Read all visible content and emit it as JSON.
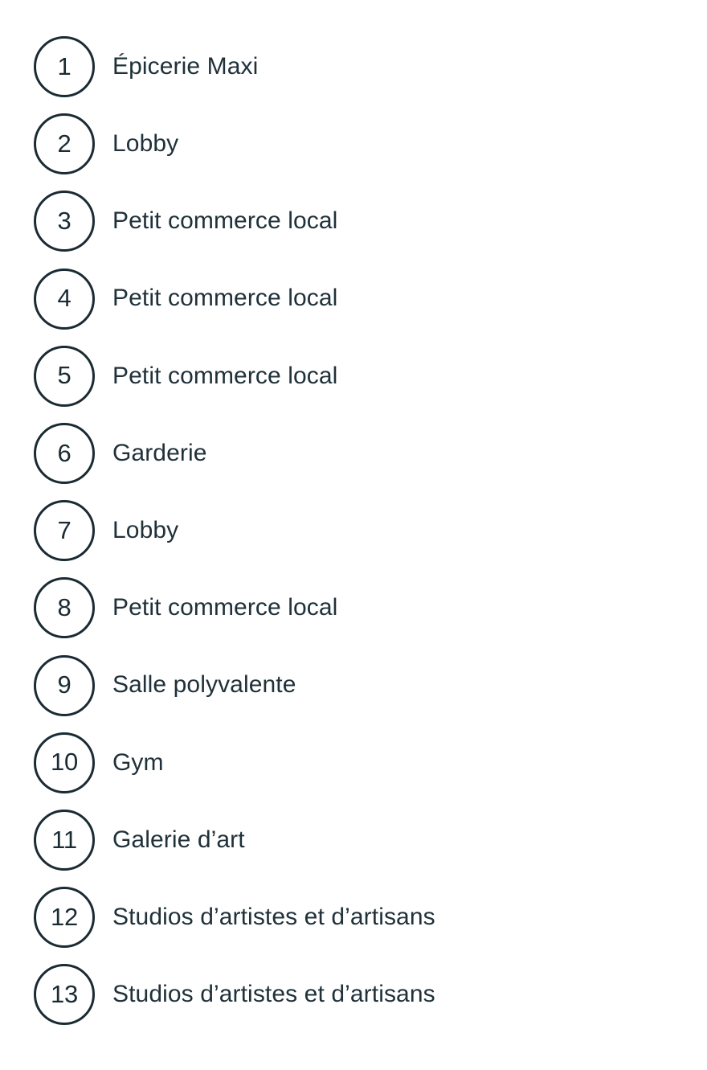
{
  "page": {
    "background_color": "#ffffff",
    "accent_color": "#1b2b33",
    "text_color": "#20313a"
  },
  "legend": {
    "items": [
      {
        "number": "1",
        "label": "Épicerie Maxi"
      },
      {
        "number": "2",
        "label": "Lobby"
      },
      {
        "number": "3",
        "label": "Petit commerce local"
      },
      {
        "number": "4",
        "label": "Petit commerce local"
      },
      {
        "number": "5",
        "label": "Petit commerce local"
      },
      {
        "number": "6",
        "label": "Garderie"
      },
      {
        "number": "7",
        "label": "Lobby"
      },
      {
        "number": "8",
        "label": "Petit commerce local"
      },
      {
        "number": "9",
        "label": "Salle polyvalente"
      },
      {
        "number": "10",
        "label": "Gym"
      },
      {
        "number": "11",
        "label": "Galerie d’art"
      },
      {
        "number": "12",
        "label": "Studios d’artistes et d’artisans"
      },
      {
        "number": "13",
        "label": "Studios d’artistes et d’artisans"
      }
    ]
  }
}
